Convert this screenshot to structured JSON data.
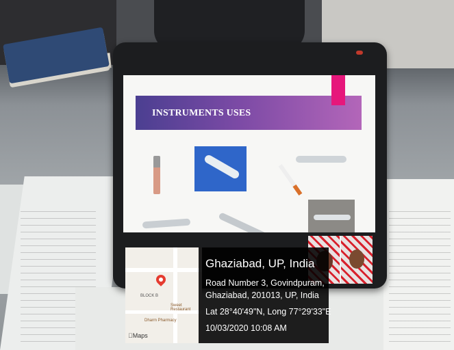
{
  "slide": {
    "title": "INSTRUMENTS USES"
  },
  "map": {
    "brand": "Maps",
    "labels": [
      "BLOCK B",
      "Dharm Pharmacy",
      "Sweet Restaurant"
    ]
  },
  "geotag": {
    "city": "Ghaziabad, UP, India",
    "address_line1": "Road Number 3, Govindpuram,",
    "address_line2": "Ghaziabad, 201013, UP, India",
    "coordinates": "Lat 28°40'49\"N, Long 77°29'33\"E",
    "timestamp": "10/03/2020 10:08 AM"
  },
  "colors": {
    "banner_start": "#4b3f91",
    "banner_end": "#b366b9",
    "accent_pink": "#e6177b",
    "map_pin": "#e53b30"
  }
}
